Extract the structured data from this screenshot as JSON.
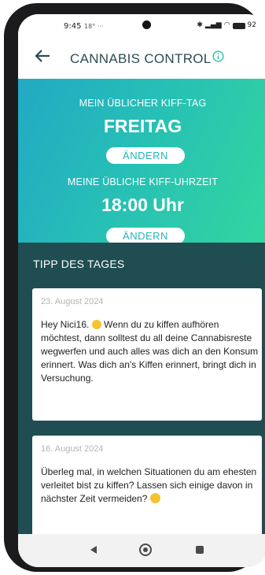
{
  "status": {
    "time": "9:45",
    "temp": "18°",
    "dots": "···",
    "battery": "92"
  },
  "header": {
    "title": "CANNABIS CONTROL",
    "back_icon": "arrow-left-icon",
    "info_icon": "info-icon"
  },
  "hero": {
    "day_label": "MEIN ÜBLICHER KIFF-TAG",
    "day_value": "FREITAG",
    "day_button": "ÄNDERN",
    "time_label": "MEINE ÜBLICHE KIFF-UHRZEIT",
    "time_value": "18:00 Uhr",
    "time_button": "ÄNDERN"
  },
  "tips": {
    "title": "TIPP DES TAGES",
    "cards": [
      {
        "date": "23. August 2024",
        "text_a": "Hey Nici16.",
        "text_b": "Wenn du zu kiffen aufhören möchtest, dann solltest du all deine Cannabisreste wegwerfen und auch alles was dich an den Konsum erinnert. Was dich an's Kiffen erinnert, bringt dich in Versuchung."
      },
      {
        "date": "16. August 2024",
        "text_a": "Überleg mal, in welchen Situationen du am ehesten verleitet bist zu kiffen? Lassen sich einige davon in nächster Zeit vermeiden?"
      }
    ]
  },
  "colors": {
    "gradient_start": "#22a9c4",
    "gradient_end": "#33d69f",
    "tips_bg": "#1f4d52",
    "title": "#2e4b54"
  }
}
